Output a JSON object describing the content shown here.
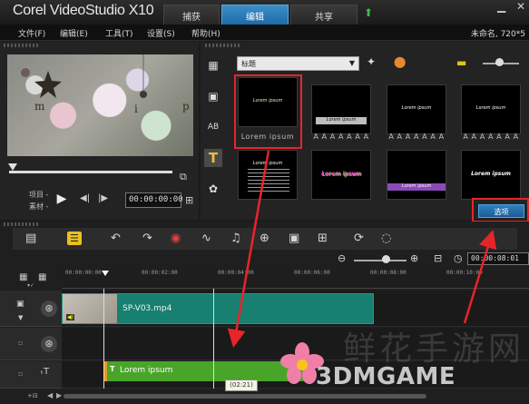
{
  "app": {
    "logo_text": "Corel VideoStudio X10",
    "steps": [
      "捕获",
      "编辑",
      "共享"
    ],
    "active_step": "编辑",
    "project_info": "未命名, 720*5"
  },
  "menu": [
    "文件(F)",
    "编辑(E)",
    "工具(T)",
    "设置(S)",
    "帮助(H)"
  ],
  "player": {
    "preview_letters": [
      "m",
      "i",
      "p"
    ],
    "mode_labels": [
      "项目 -",
      "素材 -"
    ],
    "timecode": "00:00:00:00"
  },
  "library": {
    "category": "标题",
    "thumbnails": [
      {
        "text": "Lorem ipsum",
        "caption": "Lorem ipsum"
      },
      {
        "text": "Lorem ipsum",
        "caption": "A A A A A A A"
      },
      {
        "text": "Lorem ipsum",
        "caption": "A A A A A A A"
      },
      {
        "text": "Lorem ipsum",
        "caption": "A A A A A A A"
      },
      {
        "text": "Lorem ipsum",
        "caption": ""
      },
      {
        "text": "Lorem ipsum",
        "caption": ""
      },
      {
        "text": "Lorem ipsum",
        "caption": ""
      },
      {
        "text": "Lorem ipsum",
        "caption": ""
      }
    ],
    "options_button": "选项"
  },
  "timeline": {
    "ruler_ticks": [
      "00:00:00:00",
      "00:00:02:00",
      "00:00:04:00",
      "00:00:06:00",
      "00:00:08:00",
      "00:00:10:00",
      "00:00:08:01"
    ],
    "video_clip": "SP-V03.mp4",
    "title_clip": "Lorem ipsum",
    "tooltip": "(02:21)"
  },
  "watermark": {
    "brand": "3DMGAME",
    "site_cn": "鲜花手游网"
  },
  "colors": {
    "accent_blue": "#1d6aa6",
    "highlight_red": "#e8242a",
    "video_clip": "#178070",
    "title_clip": "#48a52a",
    "title_tool": "#f0c038"
  }
}
